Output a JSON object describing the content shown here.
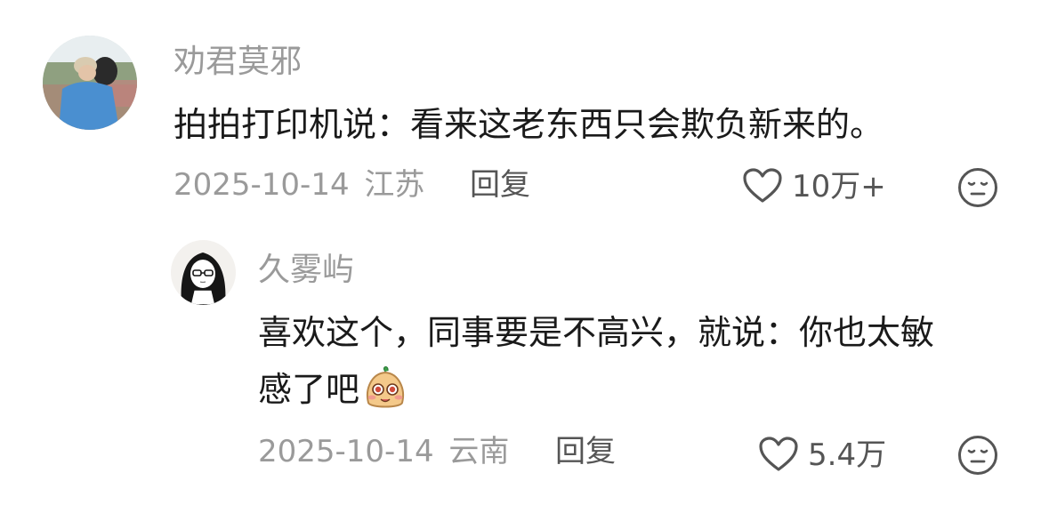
{
  "main_comment": {
    "username": "劝君莫邪",
    "text": "拍拍打印机说：看来这老东西只会欺负新来的。",
    "date": "2025-10-14",
    "location": "江苏",
    "reply_label": "回复",
    "likes": "10万+",
    "like_icon": "heart-outline-icon",
    "dislike_icon": "meh-face-icon"
  },
  "reply_comment": {
    "username": "久雾屿",
    "text_line1": "喜欢这个，同事要是不高兴，就说：你也太敏",
    "text_line2": "感了吧",
    "emoji": "cute-sticker-emoji",
    "date": "2025-10-14",
    "location": "云南",
    "reply_label": "回复",
    "likes": "5.4万",
    "like_icon": "heart-outline-icon",
    "dislike_icon": "meh-face-icon"
  },
  "colors": {
    "username": "#9a9a9a",
    "text": "#1a1a1a",
    "meta": "#9a9a9a",
    "action": "#555555"
  }
}
